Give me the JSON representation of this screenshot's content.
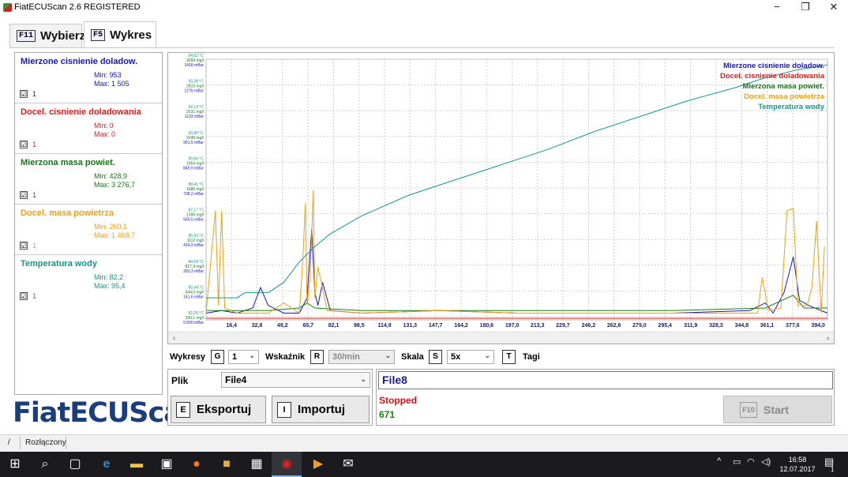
{
  "window": {
    "title": "FiatECUScan 2.6 REGISTERED",
    "minimize": "−",
    "maximize": "❐",
    "close": "✕"
  },
  "tabs": [
    {
      "key": "F11",
      "label": "Wybierz",
      "active": false
    },
    {
      "key": "F5",
      "label": "Wykres",
      "active": true
    }
  ],
  "sensors": [
    {
      "name": "Mierzone cisnienie doladow.",
      "min": "Min: 953",
      "max": "Max: 1 505",
      "color": "#1616c8",
      "checked": "☑",
      "value": "1"
    },
    {
      "name": "Docel. cisnienie doladowania",
      "min": "Min: 0",
      "max": "Max: 0",
      "color": "#e01b1b",
      "checked": "☑",
      "value": "1"
    },
    {
      "name": "Mierzona masa powiet.",
      "min": "Min: 428,9",
      "max": "Max: 3 276,7",
      "color": "#127a12",
      "checked": "☑",
      "value": "1"
    },
    {
      "name": "Docel. masa powietrza",
      "min": "Min: 260,1",
      "max": "Max: 1 468,7",
      "color": "#f0a010",
      "checked": "☑",
      "value": "1"
    },
    {
      "name": "Temperatura wody",
      "min": "Min: 82,2",
      "max": "Max: 95,4",
      "color": "#14968f",
      "checked": "☑",
      "value": "1"
    }
  ],
  "logo": "FiatECUScan",
  "chart_data": {
    "type": "line",
    "x_ticks": [
      "16,4",
      "32,8",
      "49,2",
      "65,7",
      "82,1",
      "98,5",
      "114,9",
      "131,3",
      "147,7",
      "164,2",
      "180,6",
      "197,0",
      "213,3",
      "229,7",
      "246,2",
      "262,6",
      "279,0",
      "295,4",
      "311,9",
      "328,3",
      "344,8",
      "361,1",
      "377,6",
      "394,0"
    ],
    "y_label_groups": [
      [
        "94,62 °C",
        "3099 mg/l",
        "1418 mBar"
      ],
      [
        "93,38 °C",
        "2815 mg/l",
        "1276 mBar"
      ],
      [
        "92,14 °C",
        "2531 mg/l",
        "1133 mBar"
      ],
      [
        "90,90 °C",
        "2248 mg/l",
        "991,5 mBar"
      ],
      [
        "89,66 °C",
        "1964 mg/l",
        "849,9 mBar"
      ],
      [
        "88,41 °C",
        "1680 mg/l",
        "708,2 mBar"
      ],
      [
        "87,17 °C",
        "1396 mg/l",
        "566,5 mBar"
      ],
      [
        "85,93 °C",
        "1112 mg/l",
        "424,9 mBar"
      ],
      [
        "84,69 °C",
        "827,9 mg/l",
        "283,3 mBar"
      ],
      [
        "83,44 °C",
        "544,0 mg/l",
        "141,6 mBar"
      ],
      [
        "82,20 °C",
        "260,1 mg/l",
        "0,000 mBar"
      ]
    ],
    "legend_placement": "top-right",
    "grid": true,
    "series": [
      {
        "name": "Mierzone cisnienie doladow.",
        "color": "#1616c8",
        "points": [
          [
            0,
            0.02
          ],
          [
            10,
            0.03
          ],
          [
            20,
            0.02
          ],
          [
            30,
            0.04
          ],
          [
            35,
            0.12
          ],
          [
            40,
            0.05
          ],
          [
            50,
            0.02
          ],
          [
            60,
            0.02
          ],
          [
            65,
            0.08
          ],
          [
            68,
            0.35
          ],
          [
            70,
            0.1
          ],
          [
            72,
            0.05
          ],
          [
            75,
            0.14
          ],
          [
            80,
            0.03
          ],
          [
            100,
            0.02
          ],
          [
            150,
            0.03
          ],
          [
            200,
            0.02
          ],
          [
            250,
            0.02
          ],
          [
            300,
            0.02
          ],
          [
            350,
            0.03
          ],
          [
            360,
            0.06
          ],
          [
            365,
            0.02
          ],
          [
            372,
            0.1
          ],
          [
            378,
            0.24
          ],
          [
            382,
            0.07
          ],
          [
            388,
            0.05
          ],
          [
            400,
            0.02
          ]
        ]
      },
      {
        "name": "Docel. cisnienie doladowania",
        "color": "#e01b1b",
        "points": [
          [
            0,
            0.0
          ],
          [
            400,
            0.0
          ]
        ]
      },
      {
        "name": "Mierzona masa powiet.",
        "color": "#127a12",
        "points": [
          [
            0,
            0.03
          ],
          [
            20,
            0.03
          ],
          [
            40,
            0.03
          ],
          [
            60,
            0.04
          ],
          [
            65,
            0.06
          ],
          [
            70,
            0.04
          ],
          [
            100,
            0.03
          ],
          [
            200,
            0.03
          ],
          [
            300,
            0.03
          ],
          [
            360,
            0.04
          ],
          [
            378,
            0.09
          ],
          [
            385,
            0.04
          ],
          [
            400,
            0.04
          ]
        ]
      },
      {
        "name": "Docel. masa powietrza",
        "color": "#f0a010",
        "points": [
          [
            0,
            0.02
          ],
          [
            6,
            0.42
          ],
          [
            8,
            0.05
          ],
          [
            10,
            0.42
          ],
          [
            12,
            0.04
          ],
          [
            20,
            0.02
          ],
          [
            40,
            0.02
          ],
          [
            50,
            0.06
          ],
          [
            60,
            0.02
          ],
          [
            62,
            0.2
          ],
          [
            64,
            0.45
          ],
          [
            65,
            0.05
          ],
          [
            67,
            0.16
          ],
          [
            69,
            0.5
          ],
          [
            70,
            0.08
          ],
          [
            72,
            0.2
          ],
          [
            78,
            0.03
          ],
          [
            100,
            0.02
          ],
          [
            150,
            0.03
          ],
          [
            200,
            0.02
          ],
          [
            300,
            0.02
          ],
          [
            355,
            0.02
          ],
          [
            358,
            0.16
          ],
          [
            362,
            0.03
          ],
          [
            370,
            0.04
          ],
          [
            374,
            0.42
          ],
          [
            378,
            0.43
          ],
          [
            381,
            0.05
          ],
          [
            387,
            0.05
          ],
          [
            390,
            0.12
          ],
          [
            393,
            0.38
          ],
          [
            396,
            0.02
          ],
          [
            398,
            0.28
          ]
        ]
      },
      {
        "name": "Temperatura wody",
        "color": "#14968f",
        "points": [
          [
            0,
            0.08
          ],
          [
            20,
            0.08
          ],
          [
            25,
            0.1
          ],
          [
            40,
            0.1
          ],
          [
            50,
            0.14
          ],
          [
            60,
            0.22
          ],
          [
            70,
            0.28
          ],
          [
            80,
            0.33
          ],
          [
            100,
            0.4
          ],
          [
            130,
            0.48
          ],
          [
            160,
            0.54
          ],
          [
            190,
            0.6
          ],
          [
            220,
            0.66
          ],
          [
            250,
            0.73
          ],
          [
            280,
            0.79
          ],
          [
            310,
            0.85
          ],
          [
            340,
            0.9
          ],
          [
            360,
            0.94
          ],
          [
            380,
            0.97
          ],
          [
            400,
            0.99
          ]
        ]
      }
    ]
  },
  "controls": {
    "wykresy_label": "Wykresy",
    "wykresy_key": "G",
    "wykresy_value": "1",
    "wskaznik_label": "Wskaźnik",
    "wskaznik_key": "R",
    "wskaznik_value": "30/min",
    "skala_label": "Skala",
    "skala_key": "S",
    "skala_value": "5x",
    "tagi_key": "T",
    "tagi_label": "Tagi"
  },
  "file": {
    "plik_label": "Plik",
    "plik_value": "File4",
    "export_key": "E",
    "export_label": "Eksportuj",
    "import_key": "I",
    "import_label": "Importuj"
  },
  "status": {
    "filename": "File8",
    "state": "Stopped",
    "count": "671",
    "start_key": "F10",
    "start_label": "Start"
  },
  "statusbar": {
    "cell1": "/",
    "cell2": "Rozłączony"
  },
  "taskbar": {
    "time": "16:58",
    "date": "12.07.2017",
    "notifications": "1"
  }
}
